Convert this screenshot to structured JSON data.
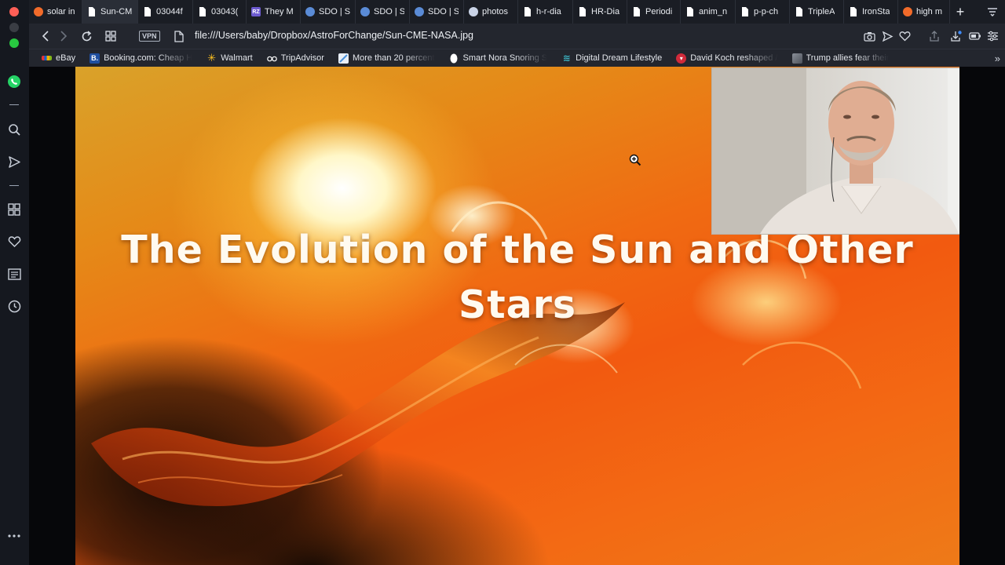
{
  "tabs": [
    {
      "label": "solar in",
      "icon": "brave-icon",
      "color": "#f26b2a"
    },
    {
      "label": "Sun-CM",
      "icon": "file-icon",
      "color": "#ffffff",
      "active": true
    },
    {
      "label": "03044f",
      "icon": "file-icon",
      "color": "#ffffff"
    },
    {
      "label": "03043(",
      "icon": "file-icon",
      "color": "#ffffff"
    },
    {
      "label": "They M",
      "icon": "rz-icon",
      "color": "#6d5bd0"
    },
    {
      "label": "SDO | S",
      "icon": "globe-icon",
      "color": "#5a8bd6"
    },
    {
      "label": "SDO | S",
      "icon": "globe-icon",
      "color": "#5a8bd6"
    },
    {
      "label": "SDO | S",
      "icon": "globe-icon",
      "color": "#5a8bd6"
    },
    {
      "label": "photos",
      "icon": "rocket-icon",
      "color": "#c9d3e6"
    },
    {
      "label": "h-r-dia",
      "icon": "file-icon",
      "color": "#ffffff"
    },
    {
      "label": "HR-Dia",
      "icon": "file-icon",
      "color": "#ffffff"
    },
    {
      "label": "Periodi",
      "icon": "file-icon",
      "color": "#ffffff"
    },
    {
      "label": "anim_n",
      "icon": "file-icon",
      "color": "#ffffff"
    },
    {
      "label": "p-p-ch",
      "icon": "file-icon",
      "color": "#ffffff"
    },
    {
      "label": "TripleA",
      "icon": "file-icon",
      "color": "#ffffff"
    },
    {
      "label": "IronSta",
      "icon": "file-icon",
      "color": "#ffffff"
    },
    {
      "label": "high m",
      "icon": "brave-icon",
      "color": "#f26b2a"
    }
  ],
  "address": {
    "vpn_label": "VPN",
    "url": "file:///Users/baby/Dropbox/AstroForChange/Sun-CME-NASA.jpg"
  },
  "bookmarks": [
    {
      "label": "eBay",
      "icon": "ebay-icon",
      "color": "#e53238"
    },
    {
      "label": "Booking.com: Cheap H",
      "icon": "booking-icon",
      "color": "#1f4fa0"
    },
    {
      "label": "Walmart",
      "icon": "walmart-icon",
      "color": "#ffc220"
    },
    {
      "label": "TripAdvisor",
      "icon": "tripadvisor-icon",
      "color": "#ffffff"
    },
    {
      "label": "More than 20 percent",
      "icon": "doc-icon",
      "color": "#4a90d9"
    },
    {
      "label": "Smart Nora Snoring S",
      "icon": "nora-icon",
      "color": "#ffffff"
    },
    {
      "label": "Digital Dream Lifestyle",
      "icon": "ddl-icon",
      "color": "#3bb3c3"
    },
    {
      "label": "David Koch reshaped /",
      "icon": "dk-icon",
      "color": "#d02a3a"
    },
    {
      "label": "Trump allies fear their",
      "icon": "news-icon",
      "color": "#8a8f98"
    }
  ],
  "slide": {
    "title_line1": "The Evolution of the Sun and Other",
    "title_line2": "Stars"
  }
}
